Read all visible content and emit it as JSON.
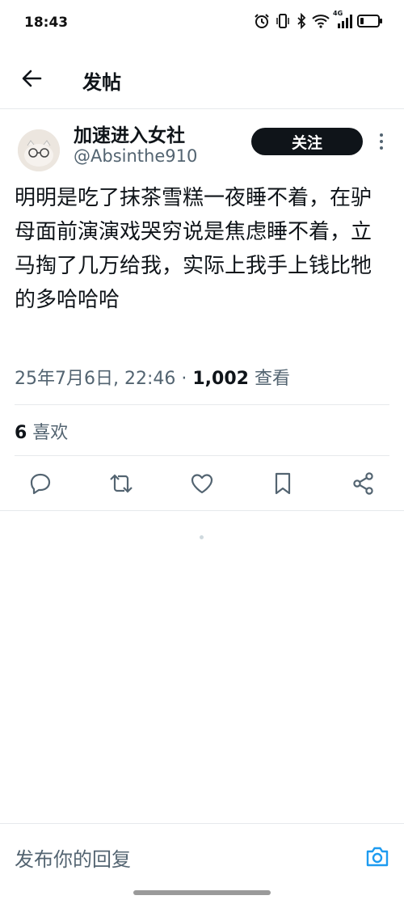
{
  "status_bar": {
    "time": "18:43",
    "network": "4G",
    "battery_icon": "battery-icon"
  },
  "header": {
    "title": "发帖",
    "back_icon": "back-arrow-icon"
  },
  "post": {
    "author_name": "加速进入女社",
    "author_handle": "@Absinthe910",
    "follow_label": "关注",
    "text": "明明是吃了抹茶雪糕一夜睡不着，在驴母面前演演戏哭穷说是焦虑睡不着，立马掏了几万给我，实际上我手上钱比牠的多哈哈哈",
    "timestamp": "25年7月6日, 22:46",
    "separator": " · ",
    "views_count": "1,002",
    "views_label": " 查看",
    "likes_count": "6",
    "likes_label": " 喜欢"
  },
  "actions": [
    "reply-icon",
    "retweet-icon",
    "like-icon",
    "bookmark-icon",
    "share-icon"
  ],
  "reply_bar": {
    "placeholder": "发布你的回复",
    "camera_icon": "camera-icon"
  },
  "colors": {
    "text": "#0f1419",
    "secondary": "#536471",
    "accent": "#1d9bf0",
    "divider": "#e6e9ec"
  }
}
